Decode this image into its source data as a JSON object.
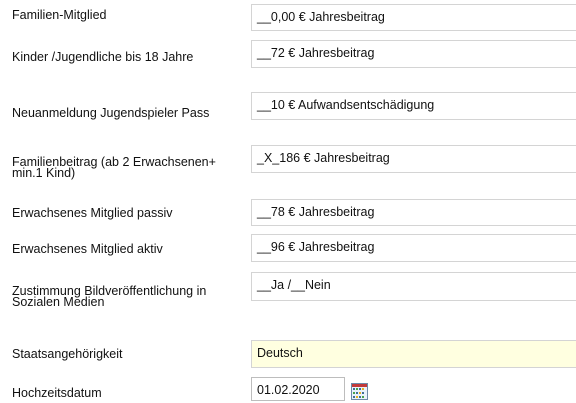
{
  "form": {
    "rows": [
      {
        "label": "Familien-Mitglied",
        "value": "__0,00 € Jahresbeitrag"
      },
      {
        "label": "Kinder /Jugendliche bis 18 Jahre",
        "value": "__72 € Jahresbeitrag"
      },
      {
        "label": "Neuanmeldung Jugendspieler Pass",
        "value": "__10 € Aufwandsentschädigung"
      },
      {
        "label": "Familienbeitrag (ab 2 Erwachsenen+ min.1 Kind)",
        "value": "_X_186 € Jahresbeitrag"
      },
      {
        "label": "Erwachsenes Mitglied passiv",
        "value": "__78 € Jahresbeitrag"
      },
      {
        "label": "Erwachsenes Mitglied aktiv",
        "value": "__96 € Jahresbeitrag"
      },
      {
        "label": "Zustimmung Bildveröffentlichung in Sozialen Medien",
        "value": "__Ja /__Nein"
      },
      {
        "label": "Staatsangehörigkeit",
        "value": "Deutsch"
      },
      {
        "label": "Hochzeitsdatum",
        "value": "01.02.2020"
      }
    ],
    "date_picker_icon": "calendar-icon",
    "highlight_color": "#ffffe0"
  }
}
